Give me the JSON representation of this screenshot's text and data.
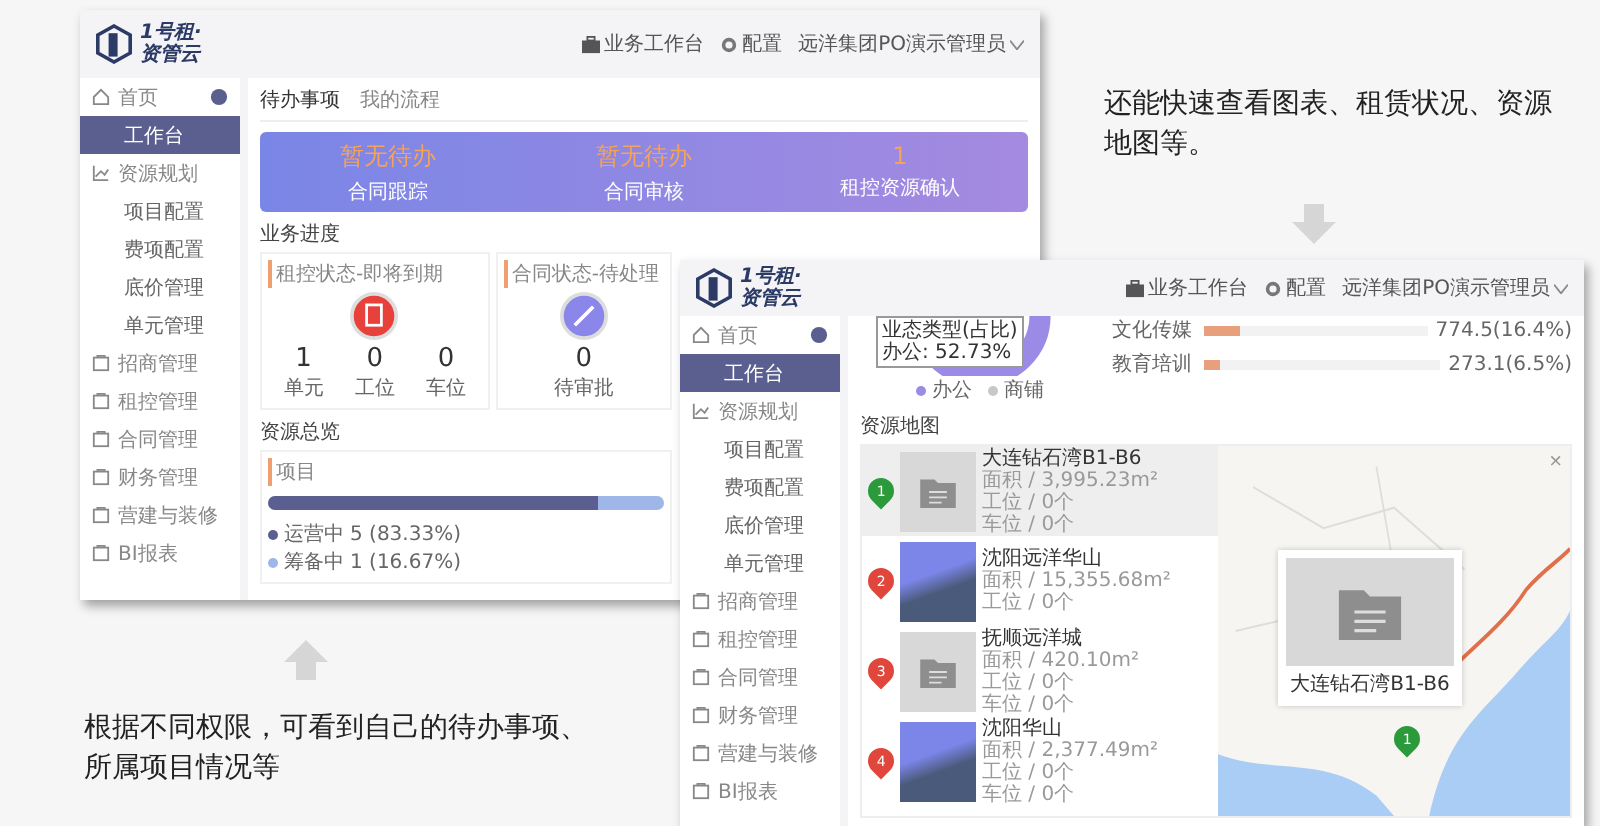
{
  "caption_top": "还能快速查看图表、租赁状况、资源地图等。",
  "caption_bottom": "根据不同权限，可看到自己的待办事项、所属项目情况等",
  "window_a": {
    "logo": [
      "1号租·",
      "资管云"
    ],
    "header_links": [
      {
        "label": "业务工作台"
      },
      {
        "label": "配置"
      }
    ],
    "user": "远洋集团PO演示管理员",
    "sidebar": {
      "items": [
        {
          "label": "首页",
          "selected": false,
          "children": [
            {
              "label": "工作台",
              "selected": true
            }
          ]
        },
        {
          "label": "资源规划",
          "selected": false,
          "children": [
            {
              "label": "项目配置",
              "selected": false
            },
            {
              "label": "费项配置",
              "selected": false
            },
            {
              "label": "底价管理",
              "selected": false
            },
            {
              "label": "单元管理",
              "selected": false
            }
          ]
        },
        {
          "label": "招商管理",
          "selected": false
        },
        {
          "label": "租控管理",
          "selected": false
        },
        {
          "label": "合同管理",
          "selected": false
        },
        {
          "label": "财务管理",
          "selected": false
        },
        {
          "label": "营建与装修",
          "selected": false
        },
        {
          "label": "BI报表",
          "selected": false
        }
      ]
    },
    "tabs": [
      {
        "label": "待办事项",
        "selected": true
      },
      {
        "label": "我的流程",
        "selected": false
      }
    ],
    "todo_stats": [
      {
        "value": "暂无待办",
        "label": "合同跟踪"
      },
      {
        "value": "暂无待办",
        "label": "合同审核"
      },
      {
        "value": "1",
        "label": "租控资源确认"
      }
    ],
    "progress_title": "业务进度",
    "progress_cards": [
      {
        "title": "租控状态-即将到期",
        "kind": "lease",
        "stats": [
          {
            "value": "1",
            "label": "单元"
          },
          {
            "value": "0",
            "label": "工位"
          },
          {
            "value": "0",
            "label": "车位"
          }
        ]
      },
      {
        "title": "合同状态-待处理",
        "kind": "contract",
        "stats": [
          {
            "value": "0",
            "label": "待审批"
          }
        ]
      }
    ],
    "overview_title": "资源总览",
    "project": {
      "title": "项目",
      "segments": [
        {
          "label": "运营中",
          "reading": "5 (83.33%)",
          "level": 0.8333,
          "color": "#5b5f8f"
        },
        {
          "label": "筹备中",
          "reading": "1 (16.67%)",
          "level": 0.1667,
          "color": "#9fb6e8"
        }
      ]
    }
  },
  "window_b": {
    "logo": [
      "1号租·",
      "资管云"
    ],
    "header_links": [
      {
        "label": "业务工作台"
      },
      {
        "label": "配置"
      }
    ],
    "user": "远洋集团PO演示管理员",
    "sidebar": {
      "items": [
        {
          "label": "首页",
          "selected": false,
          "children": [
            {
              "label": "工作台",
              "selected": true
            }
          ]
        },
        {
          "label": "资源规划",
          "selected": false,
          "children": [
            {
              "label": "项目配置",
              "selected": false
            },
            {
              "label": "费项配置",
              "selected": false
            },
            {
              "label": "底价管理",
              "selected": false
            },
            {
              "label": "单元管理",
              "selected": false
            }
          ]
        },
        {
          "label": "招商管理",
          "selected": false
        },
        {
          "label": "租控管理",
          "selected": false
        },
        {
          "label": "合同管理",
          "selected": false
        },
        {
          "label": "财务管理",
          "selected": false
        },
        {
          "label": "营建与装修",
          "selected": false
        },
        {
          "label": "BI报表",
          "selected": false
        }
      ]
    },
    "donut": {
      "tooltip": [
        "业态类型(占比)",
        "办公: 52.73%"
      ],
      "legend": [
        {
          "label": "办公",
          "color": "#9b8ae6"
        },
        {
          "label": "商铺",
          "color": "#c8c8c8"
        }
      ]
    },
    "bars": [
      {
        "label": "文化传媒",
        "level": 0.16,
        "reading": "774.5(16.4%)"
      },
      {
        "label": "教育培训",
        "level": 0.065,
        "reading": "273.1(6.5%)"
      }
    ],
    "map_title": "资源地图",
    "properties": [
      {
        "marker": "1",
        "color": "#2a9a3a",
        "selected": true,
        "kind": "folder",
        "name": "大连钻石湾B1-B6",
        "details": [
          "面积 / 3,995.23m²",
          "工位 / 0个",
          "车位 / 0个"
        ]
      },
      {
        "marker": "2",
        "color": "#e0463c",
        "selected": false,
        "kind": "photo",
        "name": "沈阳远洋华山",
        "details": [
          "面积 / 15,355.68m²",
          "工位 / 0个"
        ]
      },
      {
        "marker": "3",
        "color": "#e0463c",
        "selected": false,
        "kind": "folder",
        "name": "抚顺远洋城",
        "details": [
          "面积 / 420.10m²",
          "工位 / 0个",
          "车位 / 0个"
        ]
      },
      {
        "marker": "4",
        "color": "#e0463c",
        "selected": false,
        "kind": "photo",
        "name": "沈阳华山",
        "details": [
          "面积 / 2,377.49m²",
          "工位 / 0个",
          "车位 / 0个"
        ]
      }
    ],
    "popup": {
      "title": "大连钻石湾B1-B6",
      "close": "×"
    },
    "map_pins": [
      {
        "label": "1",
        "color": "#2a9a3a"
      }
    ]
  }
}
